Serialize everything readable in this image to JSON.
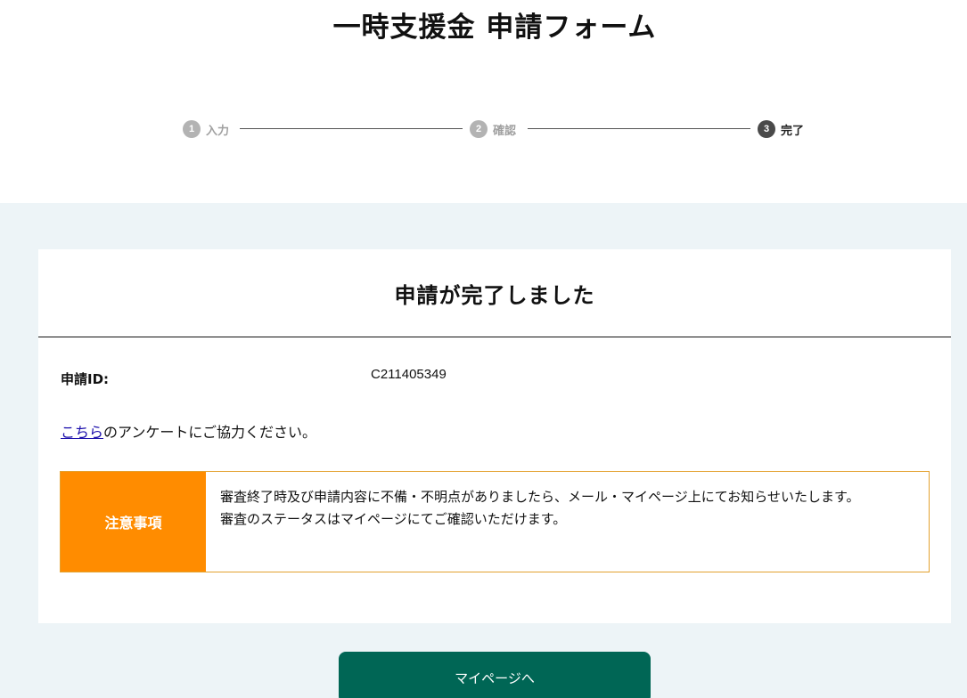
{
  "page": {
    "title": "一時支援金 申請フォーム"
  },
  "steps": [
    {
      "number": "1",
      "label": "入力",
      "state": "done"
    },
    {
      "number": "2",
      "label": "確認",
      "state": "done"
    },
    {
      "number": "3",
      "label": "完了",
      "state": "current"
    }
  ],
  "card": {
    "title": "申請が完了しました",
    "id_label": "申請ID:",
    "id_value": "C211405349",
    "survey_link": "こちら",
    "survey_text": "のアンケートにご協力ください。"
  },
  "notice": {
    "heading": "注意事項",
    "line1": "審査終了時及び申請内容に不備・不明点がありましたら、メール・マイページ上にてお知らせいたします。",
    "line2": "審査のステータスはマイページにてご確認いただけます。"
  },
  "button": {
    "mypage_label": "マイページへ"
  },
  "colors": {
    "background_band": "#edf4f7",
    "notice_accent": "#ff8c00",
    "primary_button": "#006655",
    "link": "#1a0dab"
  }
}
